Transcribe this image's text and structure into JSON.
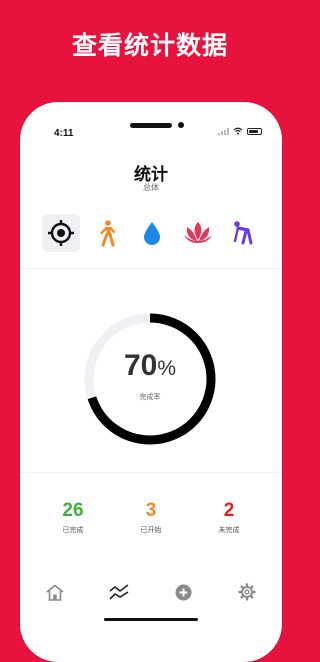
{
  "promo": {
    "headline": "查看统计数据"
  },
  "status_bar": {
    "time": "4:11"
  },
  "header": {
    "title": "统计",
    "subtitle": "总体"
  },
  "categories": [
    {
      "icon": "crosshair-icon",
      "selected": true,
      "color": "#111111"
    },
    {
      "icon": "walking-person-icon",
      "selected": false,
      "color": "#F08A24"
    },
    {
      "icon": "water-drop-icon",
      "selected": false,
      "color": "#1E88E5"
    },
    {
      "icon": "lotus-icon",
      "selected": false,
      "color": "#E8365A"
    },
    {
      "icon": "stretching-person-icon",
      "selected": false,
      "color": "#6C3CE0"
    }
  ],
  "progress": {
    "value": "70",
    "unit": "%",
    "fraction": 0.7,
    "caption": "完成率"
  },
  "stats": [
    {
      "value": "26",
      "label": "已完成",
      "color": "#3DB33D"
    },
    {
      "value": "3",
      "label": "已开始",
      "color": "#F0892A"
    },
    {
      "value": "2",
      "label": "未完成",
      "color": "#E61E1E"
    }
  ],
  "tabs": [
    {
      "icon": "home-icon",
      "active": false
    },
    {
      "icon": "trend-lines-icon",
      "active": true
    },
    {
      "icon": "add-circle-icon",
      "active": false
    },
    {
      "icon": "gear-icon",
      "active": false
    }
  ],
  "colors": {
    "background": "#E8123E",
    "ring": "#000000",
    "ring_track": "#EEF0F3"
  }
}
